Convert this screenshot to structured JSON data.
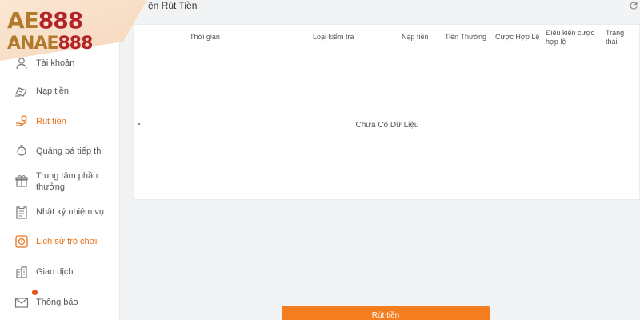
{
  "logo": {
    "line1_prefix": "AE",
    "line1_number": "888",
    "line2_prefix": "ANAE",
    "line2_number": "888"
  },
  "header": {
    "title": "ện Rút Tiền",
    "refresh_icon": "refresh-icon"
  },
  "sidebar": {
    "items": [
      {
        "label": "Tài khoản",
        "icon": "user-icon"
      },
      {
        "label": "Nạp tiền",
        "icon": "deposit-icon"
      },
      {
        "label": "Rút tiền",
        "icon": "withdraw-icon",
        "active": true
      },
      {
        "label": "Quảng bá tiếp thị",
        "icon": "marketing-icon"
      },
      {
        "label": "Trung tâm phần thưởng",
        "icon": "gift-icon"
      },
      {
        "label": "Nhật ký nhiệm vụ",
        "icon": "task-log-icon"
      },
      {
        "label": "Lịch sử trò chơi",
        "icon": "game-history-icon",
        "active": true
      },
      {
        "label": "Giao dịch",
        "icon": "transactions-icon"
      },
      {
        "label": "Thông báo",
        "icon": "mail-icon",
        "has_dot": true
      }
    ]
  },
  "table": {
    "columns": [
      "Thời gian",
      "Loại kiểm tra",
      "Nạp tiền",
      "Tiền Thưởng",
      "Cược Hợp Lệ",
      "Điều kiện cược hợp lệ",
      "Trạng thái"
    ],
    "empty_text": "Chưa Có Dữ Liệu"
  },
  "actions": {
    "withdraw_label": "Rút tiền"
  },
  "colors": {
    "accent": "#f47d20",
    "active_text": "#e8711a",
    "notification_dot": "#e5531d",
    "logo_gold": "#b27b2c",
    "logo_red": "#b2242a"
  }
}
